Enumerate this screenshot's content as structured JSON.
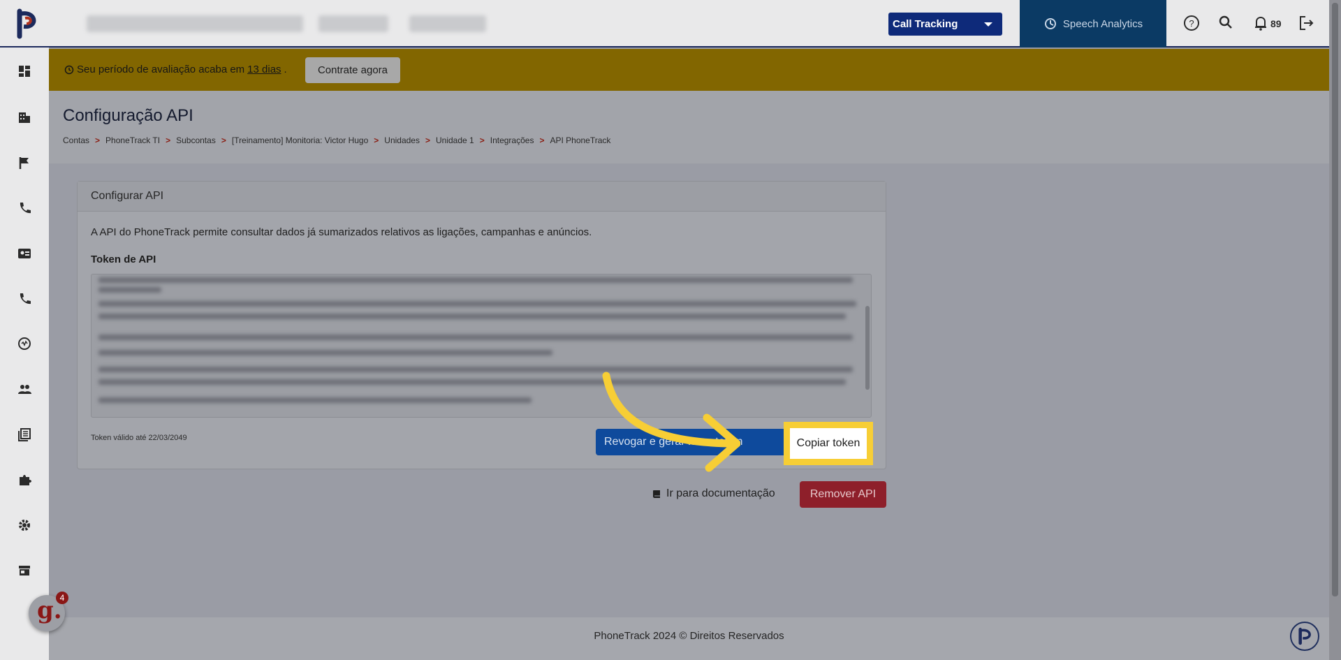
{
  "topbar": {
    "product_select": "Call Tracking",
    "speech_analytics": "Speech Analytics",
    "notifications_count": "89"
  },
  "banner": {
    "text_before": "Seu período de avaliação acaba em",
    "days_link": "13 dias",
    "text_after": ".",
    "cta": "Contrate agora"
  },
  "page": {
    "title": "Configuração API",
    "breadcrumb": [
      "Contas",
      "PhoneTrack TI",
      "Subcontas",
      "[Treinamento] Monitoria: Victor Hugo",
      "Unidades",
      "Unidade 1",
      "Integrações",
      "API PhoneTrack"
    ],
    "breadcrumb_sep": ">"
  },
  "card": {
    "header": "Configurar API",
    "description": "A API do PhoneTrack permite consultar dados já sumarizados relativos as ligações, campanhas e anúncios.",
    "token_label": "Token de API",
    "token_valid": "Token válido até 22/03/2049",
    "revoke_button": "Revogar e gerar novo token",
    "copy_button": "Copiar token"
  },
  "actions": {
    "doc_link": "Ir para documentação",
    "remove_button": "Remover API"
  },
  "footer": {
    "text": "PhoneTrack 2024 © Direitos Reservados"
  },
  "widget": {
    "badge_count": "4"
  },
  "colors": {
    "accent": "#0e2a7a",
    "highlight": "#f7ce35",
    "danger": "#8e1f2a",
    "banner": "#826600"
  }
}
